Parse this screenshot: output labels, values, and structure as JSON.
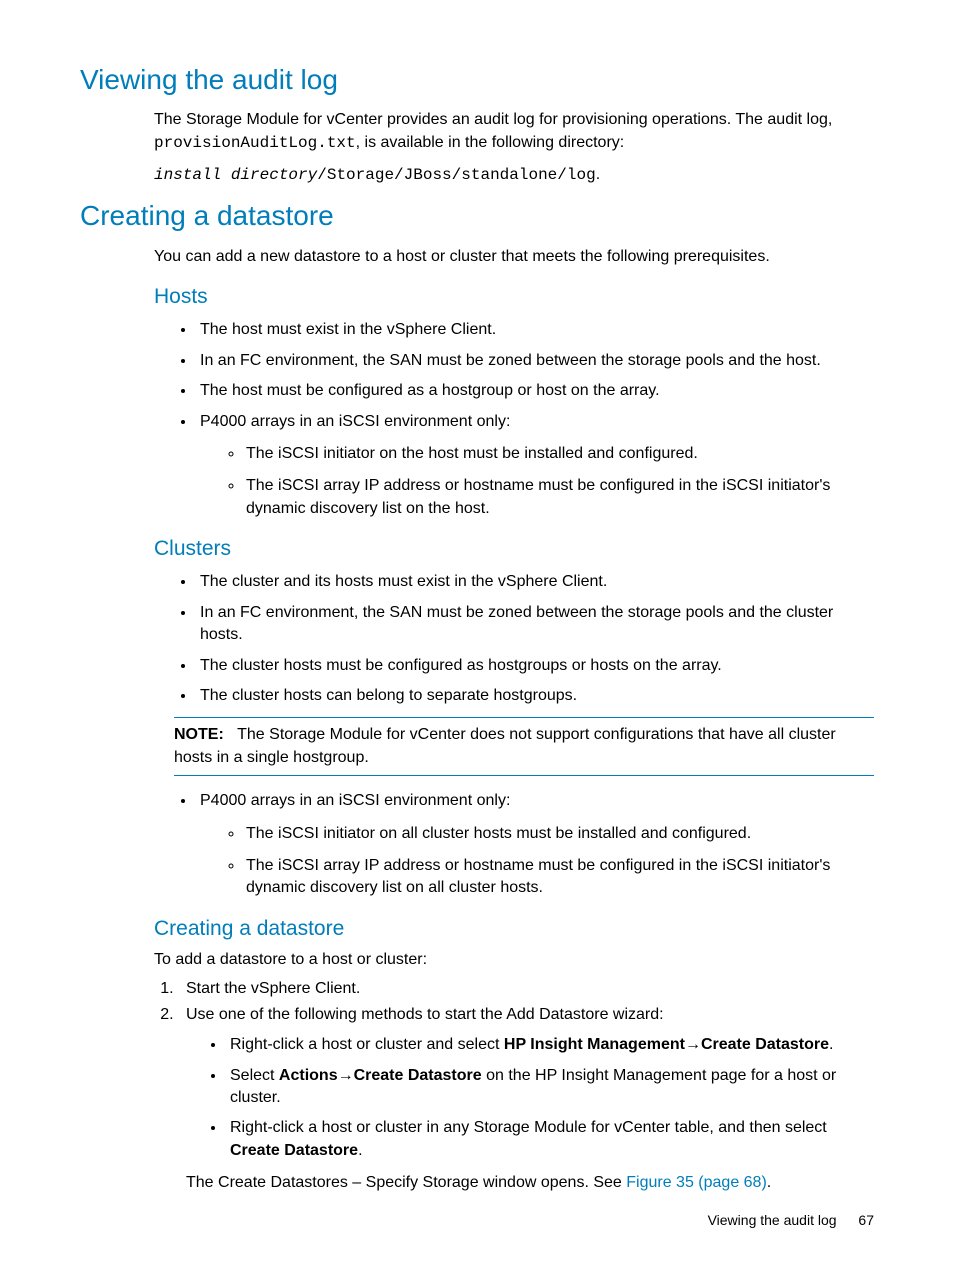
{
  "s1": {
    "title": "Viewing the audit log",
    "p1a": "The Storage Module for vCenter provides an audit log for provisioning operations. The audit log, ",
    "p1code": "provisionAuditLog.txt",
    "p1b": ", is available in the following directory:",
    "p2a": "install directory",
    "p2b": "/Storage/JBoss/standalone/log",
    "p2c": "."
  },
  "s2": {
    "title": "Creating a datastore",
    "intro": "You can add a new datastore to a host or cluster that meets the following prerequisites.",
    "hosts": {
      "title": "Hosts",
      "b1": "The host must exist in the vSphere Client.",
      "b2": "In an FC environment, the SAN must be zoned between the storage pools and the host.",
      "b3": "The host must be configured as a hostgroup or host on the array.",
      "b4": "P4000 arrays in an iSCSI environment only:",
      "b4s1": "The iSCSI initiator on the host must be installed and configured.",
      "b4s2": "The iSCSI array IP address or hostname must be configured in the iSCSI initiator's dynamic discovery list on the host."
    },
    "clusters": {
      "title": "Clusters",
      "b1": "The cluster and its hosts must exist in the vSphere Client.",
      "b2": "In an FC environment, the SAN must be zoned between the storage pools and the cluster hosts.",
      "b3": "The cluster hosts must be configured as hostgroups or hosts on the array.",
      "b4": "The cluster hosts can belong to separate hostgroups.",
      "note_label": "NOTE:",
      "note_text": "The Storage Module for vCenter does not support configurations that have all cluster hosts in a single hostgroup.",
      "b5": "P4000 arrays in an iSCSI environment only:",
      "b5s1": "The iSCSI initiator on all cluster hosts must be installed and configured.",
      "b5s2": "The iSCSI array IP address or hostname must be configured in the iSCSI initiator's dynamic discovery list on all cluster hosts."
    },
    "create": {
      "title": "Creating a datastore",
      "intro": "To add a datastore to a host or cluster:",
      "step1": "Start the vSphere Client.",
      "step2": "Use one of the following methods to start the Add Datastore wizard:",
      "s2b1a": "Right-click a host or cluster and select ",
      "s2b1b": "HP Insight Management",
      "s2b1arrow": "→",
      "s2b1c": "Create Datastore",
      "s2b1d": ".",
      "s2b2a": "Select ",
      "s2b2b": "Actions",
      "s2b2arrow": "→",
      "s2b2c": "Create Datastore",
      "s2b2d": " on the HP Insight Management page for a host or cluster.",
      "s2b3a": "Right-click a host or cluster in any Storage Module for vCenter table, and then select ",
      "s2b3b": "Create Datastore",
      "s2b3c": ".",
      "closing_a": "The Create Datastores – Specify Storage window opens. See ",
      "closing_link": "Figure 35 (page 68)",
      "closing_b": "."
    }
  },
  "footer": {
    "text": "Viewing the audit log",
    "page": "67"
  }
}
